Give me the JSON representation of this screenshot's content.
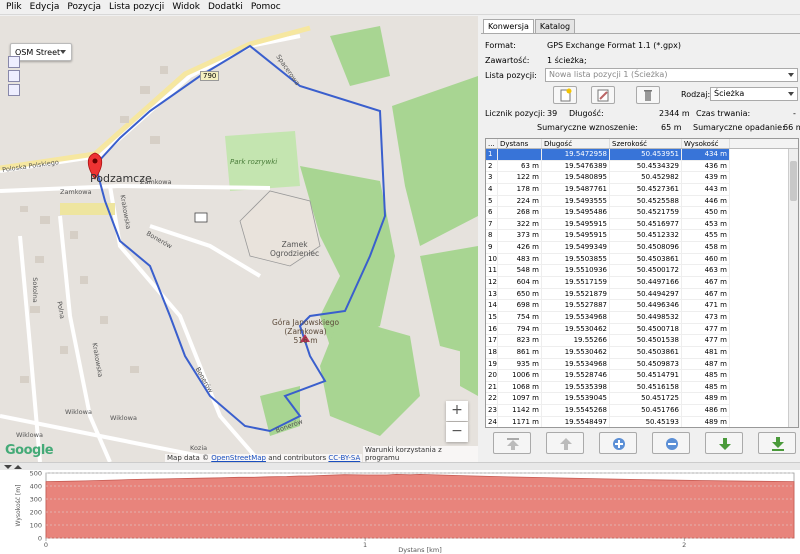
{
  "menu": [
    "Plik",
    "Edycja",
    "Pozycja",
    "Lista pozycji",
    "Widok",
    "Dodatki",
    "Pomoc"
  ],
  "map": {
    "type_label": "OSM Street",
    "places": {
      "town": "Podzamcze",
      "castle_line1": "Zamek",
      "castle_line2": "Ogrodzieniec",
      "park": "Park rozrywki",
      "hill_line1": "Góra Janowskiego",
      "hill_line2": "(Zamkowa)",
      "hill_line3": "516 m",
      "road_number": "790"
    },
    "streets": [
      "Zamkowa",
      "Zamkowa",
      "Krakowska",
      "Bonerów",
      "Bonerów",
      "Wiklowa",
      "Wiklowa",
      "Sokolna",
      "Polna",
      "Krakowska",
      "Wiklowa",
      "Kozia",
      "Bonerów",
      "Poloska Polskiego",
      "Spacerowa"
    ],
    "zoom_in": "+",
    "zoom_out": "−",
    "attribution_prefix": "Map data ©",
    "attribution_link1": "OpenStreetMap",
    "attribution_mid": "and contributors",
    "attribution_link2": "CC-BY-SA",
    "terms": "Warunki korzystania z programu",
    "logo": "Google"
  },
  "panel": {
    "tabs": [
      "Konwersja",
      "Katalog"
    ],
    "format_label": "Format:",
    "format_value": "GPS Exchange Format 1.1 (*.gpx)",
    "content_label": "Zawartość:",
    "content_value": "1 ścieżka;",
    "list_label": "Lista pozycji:",
    "list_value": "Nowa lista pozycji 1 (Ścieżka)",
    "kind_label": "Rodzaj:",
    "kind_value": "Ścieżka",
    "count_label": "Licznik pozycji:",
    "count_value": "39",
    "length_label": "Długość:",
    "length_value": "2344 m",
    "duration_label": "Czas trwania:",
    "duration_value": "-",
    "ascent_label": "Sumaryczne wznoszenie:",
    "ascent_value": "65 m",
    "descent_label": "Sumaryczne opadanie:",
    "descent_value": "66 m"
  },
  "table": {
    "headers": [
      "...",
      "Dystans",
      "Długość",
      "Szerokość",
      "Wysokość"
    ],
    "rows": [
      [
        "1",
        "",
        "19.5472958",
        "50.453951",
        "434 m"
      ],
      [
        "2",
        "63 m",
        "19.5476389",
        "50.4534329",
        "436 m"
      ],
      [
        "3",
        "122 m",
        "19.5480895",
        "50.452982",
        "439 m"
      ],
      [
        "4",
        "178 m",
        "19.5487761",
        "50.4527361",
        "443 m"
      ],
      [
        "5",
        "224 m",
        "19.5493555",
        "50.4525588",
        "446 m"
      ],
      [
        "6",
        "268 m",
        "19.5495486",
        "50.4521759",
        "450 m"
      ],
      [
        "7",
        "322 m",
        "19.5495915",
        "50.4516977",
        "453 m"
      ],
      [
        "8",
        "373 m",
        "19.5495915",
        "50.4512332",
        "455 m"
      ],
      [
        "9",
        "426 m",
        "19.5499349",
        "50.4508096",
        "458 m"
      ],
      [
        "10",
        "483 m",
        "19.5503855",
        "50.4503861",
        "460 m"
      ],
      [
        "11",
        "548 m",
        "19.5510936",
        "50.4500172",
        "463 m"
      ],
      [
        "12",
        "604 m",
        "19.5517159",
        "50.4497166",
        "467 m"
      ],
      [
        "13",
        "650 m",
        "19.5521879",
        "50.4494297",
        "467 m"
      ],
      [
        "14",
        "698 m",
        "19.5527887",
        "50.4496346",
        "471 m"
      ],
      [
        "15",
        "754 m",
        "19.5534968",
        "50.4498532",
        "473 m"
      ],
      [
        "16",
        "794 m",
        "19.5530462",
        "50.4500718",
        "477 m"
      ],
      [
        "17",
        "823 m",
        "19.55266",
        "50.4501538",
        "477 m"
      ],
      [
        "18",
        "861 m",
        "19.5530462",
        "50.4503861",
        "481 m"
      ],
      [
        "19",
        "935 m",
        "19.5534968",
        "50.4509873",
        "487 m"
      ],
      [
        "20",
        "1006 m",
        "19.5528746",
        "50.4514791",
        "485 m"
      ],
      [
        "21",
        "1068 m",
        "19.5535398",
        "50.4516158",
        "485 m"
      ],
      [
        "22",
        "1097 m",
        "19.5539045",
        "50.451725",
        "489 m"
      ],
      [
        "23",
        "1142 m",
        "19.5545268",
        "50.451766",
        "486 m"
      ],
      [
        "24",
        "1171 m",
        "19.5548497",
        "50.45193",
        "489 m"
      ]
    ]
  },
  "profile": {
    "ylabel": "Wysokość [m]",
    "xlabel": "Dystans [km]",
    "yticks": [
      "500",
      "400",
      "300",
      "200",
      "100",
      "0"
    ],
    "xticks": [
      "0",
      "1",
      "2"
    ]
  },
  "chart_data": {
    "type": "area",
    "xlabel": "Dystans [km]",
    "ylabel": "Wysokość [m]",
    "x": [
      0,
      0.063,
      0.122,
      0.178,
      0.224,
      0.268,
      0.322,
      0.373,
      0.426,
      0.483,
      0.548,
      0.604,
      0.65,
      0.698,
      0.754,
      0.794,
      0.823,
      0.861,
      0.935,
      1.006,
      1.068,
      1.097,
      1.142,
      1.171,
      1.3,
      1.45,
      1.6,
      1.75,
      1.9,
      2.05,
      2.2,
      2.344
    ],
    "values": [
      434,
      436,
      439,
      443,
      446,
      450,
      453,
      455,
      458,
      460,
      463,
      467,
      467,
      471,
      473,
      477,
      477,
      481,
      487,
      485,
      485,
      489,
      486,
      489,
      480,
      470,
      462,
      455,
      448,
      442,
      437,
      434
    ],
    "xlim": [
      0,
      2.344
    ],
    "ylim": [
      0,
      500
    ],
    "grid": true,
    "color": "#e8847c"
  }
}
